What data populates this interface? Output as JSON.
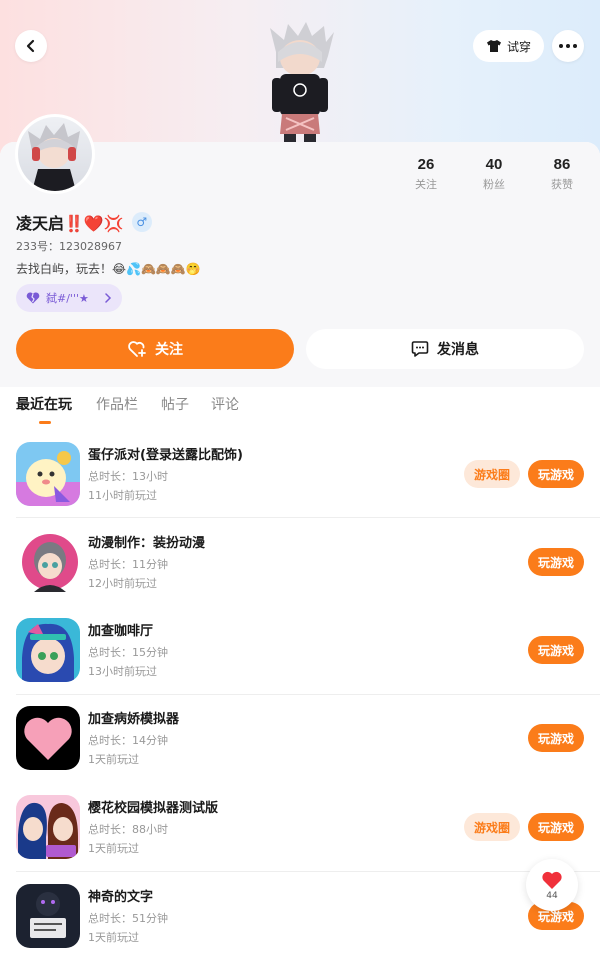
{
  "header": {
    "tryon_label": "试穿"
  },
  "profile": {
    "stats": [
      {
        "value": "26",
        "label": "关注"
      },
      {
        "value": "40",
        "label": "粉丝"
      },
      {
        "value": "86",
        "label": "获赞"
      }
    ],
    "username": "凌天启‼️❤️💢",
    "gender_symbol": "♂",
    "uid": "233号：123028967",
    "bio": "去找白屿，玩去！😂💦🙈🙈🙈🤭",
    "tag_label": "弑#/'''★"
  },
  "actions": {
    "follow_label": "关注",
    "message_label": "发消息"
  },
  "tabs": [
    {
      "label": "最近在玩",
      "active": true
    },
    {
      "label": "作品栏",
      "active": false
    },
    {
      "label": "帖子",
      "active": false
    },
    {
      "label": "评论",
      "active": false
    }
  ],
  "games": [
    {
      "title": "蛋仔派对(登录送露比配饰)",
      "duration": "总时长：13小时",
      "last_played": "11小时前玩过",
      "has_circle": true,
      "circle_label": "游戏圈",
      "play_label": "玩游戏",
      "icon": "eggy-party-icon"
    },
    {
      "title": "动漫制作：装扮动漫",
      "duration": "总时长：11分钟",
      "last_played": "12小时前玩过",
      "has_circle": false,
      "play_label": "玩游戏",
      "icon": "anime-dressup-icon"
    },
    {
      "title": "加查咖啡厅",
      "duration": "总时长：15分钟",
      "last_played": "13小时前玩过",
      "has_circle": false,
      "play_label": "玩游戏",
      "icon": "gacha-cafe-icon"
    },
    {
      "title": "加查病娇模拟器",
      "duration": "总时长：14分钟",
      "last_played": "1天前玩过",
      "has_circle": false,
      "play_label": "玩游戏",
      "icon": "heart-game-icon"
    },
    {
      "title": "樱花校园模拟器测试版",
      "duration": "总时长：88小时",
      "last_played": "1天前玩过",
      "has_circle": true,
      "circle_label": "游戏圈",
      "play_label": "玩游戏",
      "icon": "sakura-school-icon"
    },
    {
      "title": "神奇的文字",
      "duration": "总时长：51分钟",
      "last_played": "1天前玩过",
      "has_circle": false,
      "play_label": "玩游戏",
      "icon": "magic-text-icon"
    }
  ],
  "floating_like": {
    "count": "44"
  },
  "colors": {
    "accent": "#fb7c1a",
    "accent_soft": "#fde8d9",
    "tag_bg": "#ebe5fa",
    "tag_text": "#7a5bd6"
  }
}
